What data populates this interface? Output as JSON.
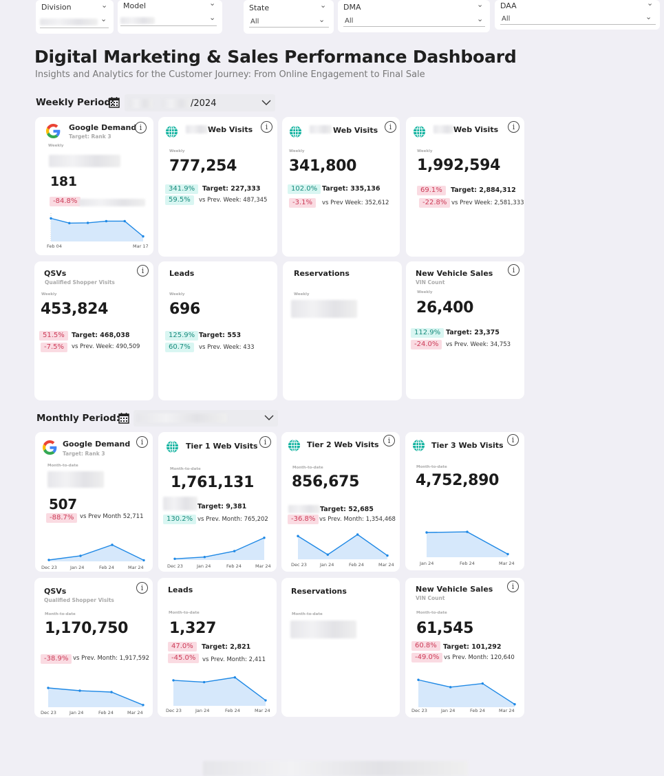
{
  "filters": {
    "division": {
      "label": "Division",
      "value": ""
    },
    "model": {
      "label": "Model",
      "value": ""
    },
    "state": {
      "label": "State",
      "value": "All"
    },
    "dma": {
      "label": "DMA",
      "value": "All"
    },
    "daa": {
      "label": "DAA",
      "value": "All"
    }
  },
  "header": {
    "title": "Digital Marketing & Sales Performance Dashboard",
    "subtitle": "Insights and Analytics for the Customer Journey: From Online Engagement to Final Sale"
  },
  "weekly": {
    "period_label": "Weekly Period:",
    "period_value": "/2024",
    "google": {
      "title": "Google Demand",
      "subtitle": "Target: Rank 3",
      "period": "Weekly",
      "value": "181",
      "delta": "-84.8%",
      "ticks": [
        "Feb 04",
        "Mar 17"
      ],
      "series": [
        82,
        65,
        66,
        72,
        72,
        18
      ]
    },
    "web1": {
      "title": "Web Visits",
      "period": "Weekly",
      "value": "777,254",
      "target_pct": "341.9%",
      "target": "Target: 227,333",
      "prev_pct": "59.5%",
      "prev": "vs Prev. Week: 487,345"
    },
    "web2": {
      "title": "Web Visits",
      "period": "Weekly",
      "value": "341,800",
      "target_pct": "102.0%",
      "target": "Target: 335,136",
      "prev_pct": "-3.1%",
      "prev": "vs Prev Week: 352,612"
    },
    "web3": {
      "title": "Web Visits",
      "period": "Weekly",
      "value": "1,992,594",
      "target_pct": "69.1%",
      "target": "Target: 2,884,312",
      "prev_pct": "-22.8%",
      "prev": "vs Prev Week: 2,581,333"
    },
    "qsv": {
      "title": "QSVs",
      "subtitle": "Qualified Shopper Visits",
      "period": "Weekly",
      "value": "453,824",
      "target_pct": "51.5%",
      "target": "Target: 468,038",
      "prev_pct": "-7.5%",
      "prev": "vs Prev. Week: 490,509"
    },
    "leads": {
      "title": "Leads",
      "period": "Weekly",
      "value": "696",
      "target_pct": "125.9%",
      "target": "Target: 553",
      "prev_pct": "60.7%",
      "prev": "vs Prev. Week: 433"
    },
    "reservations": {
      "title": "Reservations",
      "period": "Weekly"
    },
    "nvs": {
      "title": "New Vehicle Sales",
      "subtitle": "VIN Count",
      "period": "Weekly",
      "value": "26,400",
      "target_pct": "112.9%",
      "target": "Target: 23,375",
      "prev_pct": "-24.0%",
      "prev": "vs Prev. Week: 34,753"
    }
  },
  "monthly": {
    "period_label": "Monthly Period:",
    "google": {
      "title": "Google Demand",
      "subtitle": "Target: Rank 3",
      "period": "Month-to-date",
      "value": "507",
      "prev_pct": "-88.7%",
      "prev": "vs Prev Month 52,711",
      "ticks": [
        "Dec 23",
        "Jan 24",
        "Feb 24",
        "Mar 24"
      ],
      "series": [
        5,
        20,
        60,
        4
      ]
    },
    "tier1": {
      "title": "Tier 1 Web Visits",
      "period": "Month-to-date",
      "value": "1,761,131",
      "target": "Target: 9,381",
      "prev_pct": "130.2%",
      "prev": "vs Prev. Month: 765,202",
      "ticks": [
        "Dec 23",
        "Jan 24",
        "Feb 24",
        "Mar 24"
      ],
      "series": [
        4,
        10,
        30,
        75
      ]
    },
    "tier2": {
      "title": "Tier 2 Web Visits",
      "period": "Month-to-date",
      "value": "856,675",
      "target": "Target: 52,685",
      "prev_pct": "-36.8%",
      "prev": "vs Prev. Month: 1,354,468",
      "ticks": [
        "Dec 23",
        "Jan 24",
        "Feb 24",
        "Mar 24"
      ],
      "series": [
        75,
        15,
        80,
        12
      ]
    },
    "tier3": {
      "title": "Tier 3 Web Visits",
      "period": "Month-to-date",
      "value": "4,752,890",
      "ticks": [
        "Jan 24",
        "Feb 24",
        "Mar 24"
      ],
      "series": [
        80,
        82,
        10
      ]
    },
    "qsv": {
      "title": "QSVs",
      "subtitle": "Qualified Shopper Visits",
      "period": "Month-to-date",
      "value": "1,170,750",
      "prev_pct": "-38.9%",
      "prev": "vs Prev. Month: 1,917,592",
      "ticks": [
        "Dec 23",
        "Jan 24",
        "Feb 24",
        "Mar 24"
      ],
      "series": [
        70,
        60,
        55,
        8
      ]
    },
    "leads": {
      "title": "Leads",
      "period": "Month-to-date",
      "value": "1,327",
      "target_pct": "47.0%",
      "target": "Target: 2,821",
      "prev_pct": "-45.0%",
      "prev": "vs Prev. Month: 2,411",
      "ticks": [
        "Dec 23",
        "Jan 24",
        "Feb 24",
        "Mar 24"
      ],
      "series": [
        70,
        65,
        78,
        15
      ]
    },
    "reservations": {
      "title": "Reservations",
      "period": "Month-to-date"
    },
    "nvs": {
      "title": "New Vehicle Sales",
      "subtitle": "VIN Count",
      "period": "Month-to-date",
      "value": "61,545",
      "target_pct": "60.8%",
      "target": "Target: 101,292",
      "prev_pct": "-49.0%",
      "prev": "vs Prev. Month: 120,640",
      "ticks": [
        "Dec 23",
        "Jan 24",
        "Feb 24",
        "Mar 24"
      ],
      "series": [
        75,
        55,
        65,
        8
      ]
    }
  },
  "colors": {
    "accent": "#1e88e5",
    "fill": "#d6e8fb",
    "positive": "#168b7c",
    "negative": "#cc3b57"
  }
}
